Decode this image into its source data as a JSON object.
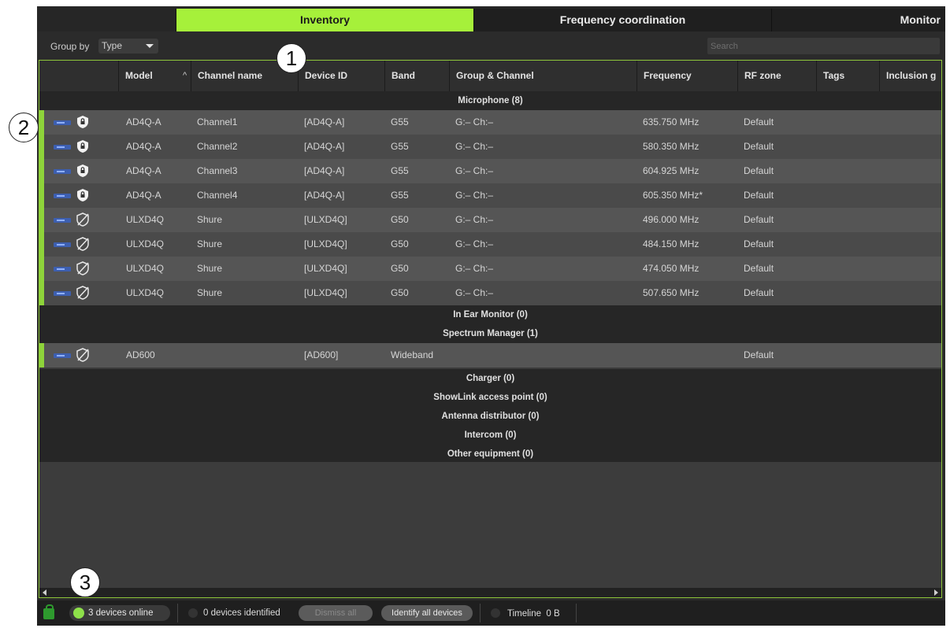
{
  "tabs": {
    "inventory": "Inventory",
    "frequency": "Frequency coordination",
    "monitor": "Monitor"
  },
  "toolbar": {
    "group_by_label": "Group by",
    "group_by_value": "Type",
    "search_placeholder": "Search"
  },
  "columns": {
    "model": "Model",
    "sort_indicator": "^",
    "channel_name": "Channel name",
    "device_id": "Device ID",
    "band": "Band",
    "group_channel": "Group & Channel",
    "frequency": "Frequency",
    "rf_zone": "RF zone",
    "tags": "Tags",
    "inclusion": "Inclusion g"
  },
  "groups": {
    "microphone": "Microphone (8)",
    "in_ear_monitor": "In Ear Monitor (0)",
    "spectrum_manager": "Spectrum Manager (1)",
    "charger": "Charger (0)",
    "showlink": "ShowLink access point (0)",
    "antenna": "Antenna distributor (0)",
    "intercom": "Intercom (0)",
    "other": "Other equipment (0)"
  },
  "microphone_rows": [
    {
      "model": "AD4Q-A",
      "channel": "Channel1",
      "device_id": "[AD4Q-A]",
      "band": "G55",
      "group_channel": "G:– Ch:–",
      "frequency": "635.750 MHz",
      "rf_zone": "Default",
      "icon": "shield-lock-icon"
    },
    {
      "model": "AD4Q-A",
      "channel": "Channel2",
      "device_id": "[AD4Q-A]",
      "band": "G55",
      "group_channel": "G:– Ch:–",
      "frequency": "580.350 MHz",
      "rf_zone": "Default",
      "icon": "shield-lock-icon"
    },
    {
      "model": "AD4Q-A",
      "channel": "Channel3",
      "device_id": "[AD4Q-A]",
      "band": "G55",
      "group_channel": "G:– Ch:–",
      "frequency": "604.925 MHz",
      "rf_zone": "Default",
      "icon": "shield-lock-icon"
    },
    {
      "model": "AD4Q-A",
      "channel": "Channel4",
      "device_id": "[AD4Q-A]",
      "band": "G55",
      "group_channel": "G:– Ch:–",
      "frequency": "605.350 MHz*",
      "rf_zone": "Default",
      "icon": "shield-lock-icon"
    },
    {
      "model": "ULXD4Q",
      "channel": "Shure",
      "device_id": "[ULXD4Q]",
      "band": "G50",
      "group_channel": "G:– Ch:–",
      "frequency": "496.000 MHz",
      "rf_zone": "Default",
      "icon": "shield-off-icon"
    },
    {
      "model": "ULXD4Q",
      "channel": "Shure",
      "device_id": "[ULXD4Q]",
      "band": "G50",
      "group_channel": "G:– Ch:–",
      "frequency": "484.150 MHz",
      "rf_zone": "Default",
      "icon": "shield-off-icon"
    },
    {
      "model": "ULXD4Q",
      "channel": "Shure",
      "device_id": "[ULXD4Q]",
      "band": "G50",
      "group_channel": "G:– Ch:–",
      "frequency": "474.050 MHz",
      "rf_zone": "Default",
      "icon": "shield-off-icon"
    },
    {
      "model": "ULXD4Q",
      "channel": "Shure",
      "device_id": "[ULXD4Q]",
      "band": "G50",
      "group_channel": "G:– Ch:–",
      "frequency": "507.650 MHz",
      "rf_zone": "Default",
      "icon": "shield-off-icon"
    }
  ],
  "spectrum_rows": [
    {
      "model": "AD600",
      "channel": "",
      "device_id": "[AD600]",
      "band": "Wideband",
      "group_channel": "",
      "frequency": "",
      "rf_zone": "Default",
      "icon": "shield-off-icon"
    }
  ],
  "statusbar": {
    "online": "3 devices online",
    "identified": "0 devices identified",
    "dismiss_all": "Dismiss all",
    "identify_all": "Identify all devices",
    "timeline": "Timeline",
    "timeline_size": "0 B"
  },
  "callouts": [
    "1",
    "2",
    "3"
  ],
  "colors": {
    "accent_green": "#a6f03a",
    "row_accent": "#8ed43a",
    "online_dot": "#8ee04a"
  }
}
